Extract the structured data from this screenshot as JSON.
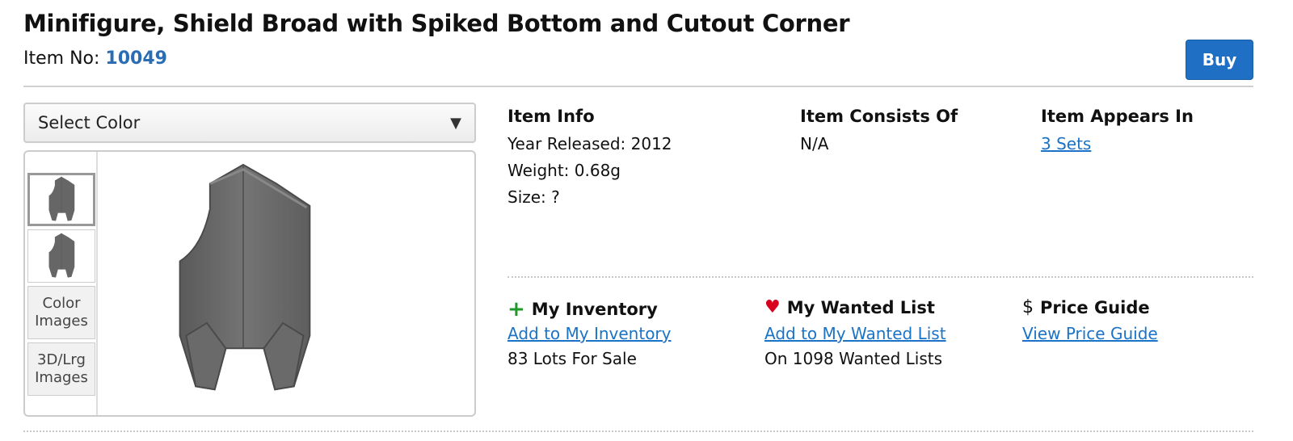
{
  "item": {
    "title": "Minifigure, Shield Broad with Spiked Bottom and Cutout Corner",
    "item_no_label": "Item No:",
    "item_no": "10049"
  },
  "buy_label": "Buy",
  "color_select": {
    "label": "Select Color",
    "arrow": "▼"
  },
  "thumbnails": {
    "color_images": "Color Images",
    "lrg_images": "3D/Lrg Images"
  },
  "info": {
    "heading": "Item Info",
    "year": "Year Released: 2012",
    "weight": "Weight: 0.68g",
    "size": "Size: ?"
  },
  "consists": {
    "heading": "Item Consists Of",
    "value": "N/A"
  },
  "appears": {
    "heading": "Item Appears In",
    "link": "3 Sets"
  },
  "inventory": {
    "icon": "+",
    "heading": "My Inventory",
    "link": "Add to My Inventory",
    "text": "83 Lots For Sale"
  },
  "wanted": {
    "icon": "♥",
    "heading": "My Wanted List",
    "link": "Add to My Wanted List",
    "text": "On 1098 Wanted Lists"
  },
  "price": {
    "icon": "$",
    "heading": "Price Guide",
    "link": "View Price Guide"
  },
  "colors": {
    "accent": "#1f6fc4",
    "link": "#1a73c7",
    "plus": "#1e9a2a",
    "heart": "#d8001c"
  }
}
